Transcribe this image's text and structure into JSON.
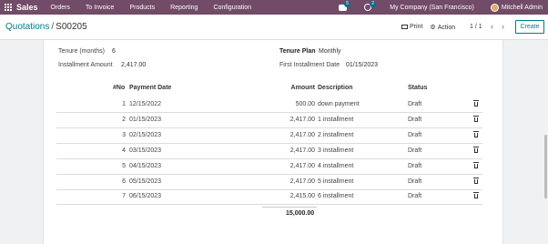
{
  "topbar": {
    "app_name": "Sales",
    "menus": [
      "Orders",
      "To Invoice",
      "Products",
      "Reporting",
      "Configuration"
    ],
    "chat_count": "5",
    "activity_count": "2",
    "company": "My Company (San Francisco)",
    "user": "Mitchell Admin",
    "color": "#714b67"
  },
  "control_panel": {
    "breadcrumb_parent": "Quotations",
    "breadcrumb_current": "S00205",
    "print_label": "Print",
    "action_label": "Action",
    "pager": "1 / 1",
    "create_label": "Create"
  },
  "form": {
    "tenure_label": "Tenure (months)",
    "tenure_value": "6",
    "installment_label": "Installment Amount",
    "installment_value": "2,417.00",
    "tenure_plan_label": "Tenure Plan",
    "tenure_plan_value": "Monthly",
    "first_installment_label": "First Installment Date",
    "first_installment_value": "01/15/2023"
  },
  "table": {
    "headers": {
      "no": "#No",
      "date": "Payment Date",
      "amount": "Amount",
      "description": "Description",
      "status": "Status"
    },
    "rows": [
      {
        "no": "1",
        "date": "12/15/2022",
        "amount": "500.00",
        "description": "down payment",
        "status": "Draft"
      },
      {
        "no": "2",
        "date": "01/15/2023",
        "amount": "2,417.00",
        "description": "1 installment",
        "status": "Draft"
      },
      {
        "no": "3",
        "date": "02/15/2023",
        "amount": "2,417.00",
        "description": "2 installment",
        "status": "Draft"
      },
      {
        "no": "4",
        "date": "03/15/2023",
        "amount": "2,417.00",
        "description": "3 installment",
        "status": "Draft"
      },
      {
        "no": "5",
        "date": "04/15/2023",
        "amount": "2,417.00",
        "description": "4 installment",
        "status": "Draft"
      },
      {
        "no": "6",
        "date": "05/15/2023",
        "amount": "2,417.00",
        "description": "5 installment",
        "status": "Draft"
      },
      {
        "no": "7",
        "date": "06/15/2023",
        "amount": "2,415.00",
        "description": "6 installment",
        "status": "Draft"
      }
    ],
    "total": "15,000.00"
  }
}
